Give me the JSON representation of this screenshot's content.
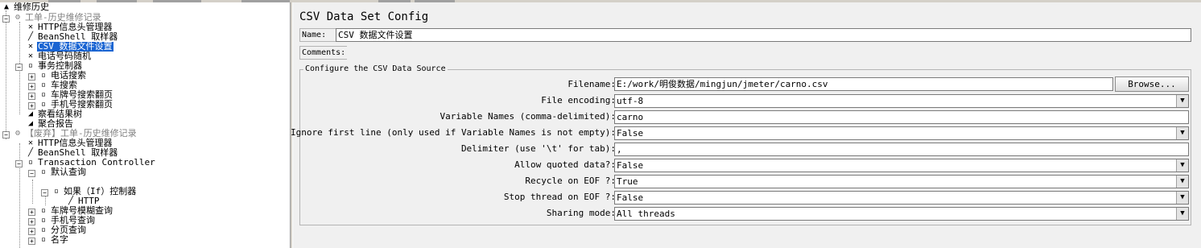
{
  "tree": {
    "items": [
      {
        "label": "维修历史"
      },
      {
        "label": "工单-历史维修记录"
      },
      {
        "label": "HTTP信息头管理器"
      },
      {
        "label": "BeanShell 取样器"
      },
      {
        "label": "CSV 数据文件设置"
      },
      {
        "label": "电话号码随机"
      },
      {
        "label": "事务控制器"
      },
      {
        "label": "电话搜索"
      },
      {
        "label": "车搜索"
      },
      {
        "label": "车牌号搜索翻页"
      },
      {
        "label": "手机号搜索翻页"
      },
      {
        "label": "察看结果树"
      },
      {
        "label": "聚合报告"
      },
      {
        "label": "【废弃】工单-历史维修记录"
      },
      {
        "label": "HTTP信息头管理器"
      },
      {
        "label": "BeanShell 取样器"
      },
      {
        "label": "Transaction Controller"
      },
      {
        "label": "默认查询"
      },
      {
        "label": "如果（If）控制器"
      },
      {
        "label": "HTTP"
      },
      {
        "label": "车牌号模糊查询"
      },
      {
        "label": "手机号查询"
      },
      {
        "label": "分页查询"
      },
      {
        "label": "名字"
      }
    ]
  },
  "config": {
    "title": "CSV Data Set Config",
    "name_label": "Name:",
    "name_value": "CSV 数据文件设置",
    "comments_label": "Comments:",
    "comments_value": "",
    "section_title": "Configure the CSV Data Source",
    "filename_label": "Filename:",
    "filename_value": "E:/work/明俊数据/mingjun/jmeter/carno.csv",
    "browse_label": "Browse...",
    "encoding_label": "File encoding:",
    "encoding_value": "utf-8",
    "varnames_label": "Variable Names (comma-delimited):",
    "varnames_value": "carno",
    "ignore_label": "Ignore first line (only used if Variable Names is not empty):",
    "ignore_value": "False",
    "delimiter_label": "Delimiter (use '\\t' for tab):",
    "delimiter_value": ",",
    "quoted_label": "Allow quoted data?:",
    "quoted_value": "False",
    "recycle_label": "Recycle on EOF ?:",
    "recycle_value": "True",
    "stop_label": "Stop thread on EOF ?:",
    "stop_value": "False",
    "sharing_label": "Sharing mode:",
    "sharing_value": "All threads"
  },
  "icons": {
    "testplan": "test-plan-icon",
    "threadgroup": "thread-group-icon",
    "config": "config-element-icon",
    "sampler": "sampler-icon",
    "controller": "controller-icon",
    "listener": "listener-icon"
  },
  "colors": {
    "selection": "#1964d2"
  }
}
